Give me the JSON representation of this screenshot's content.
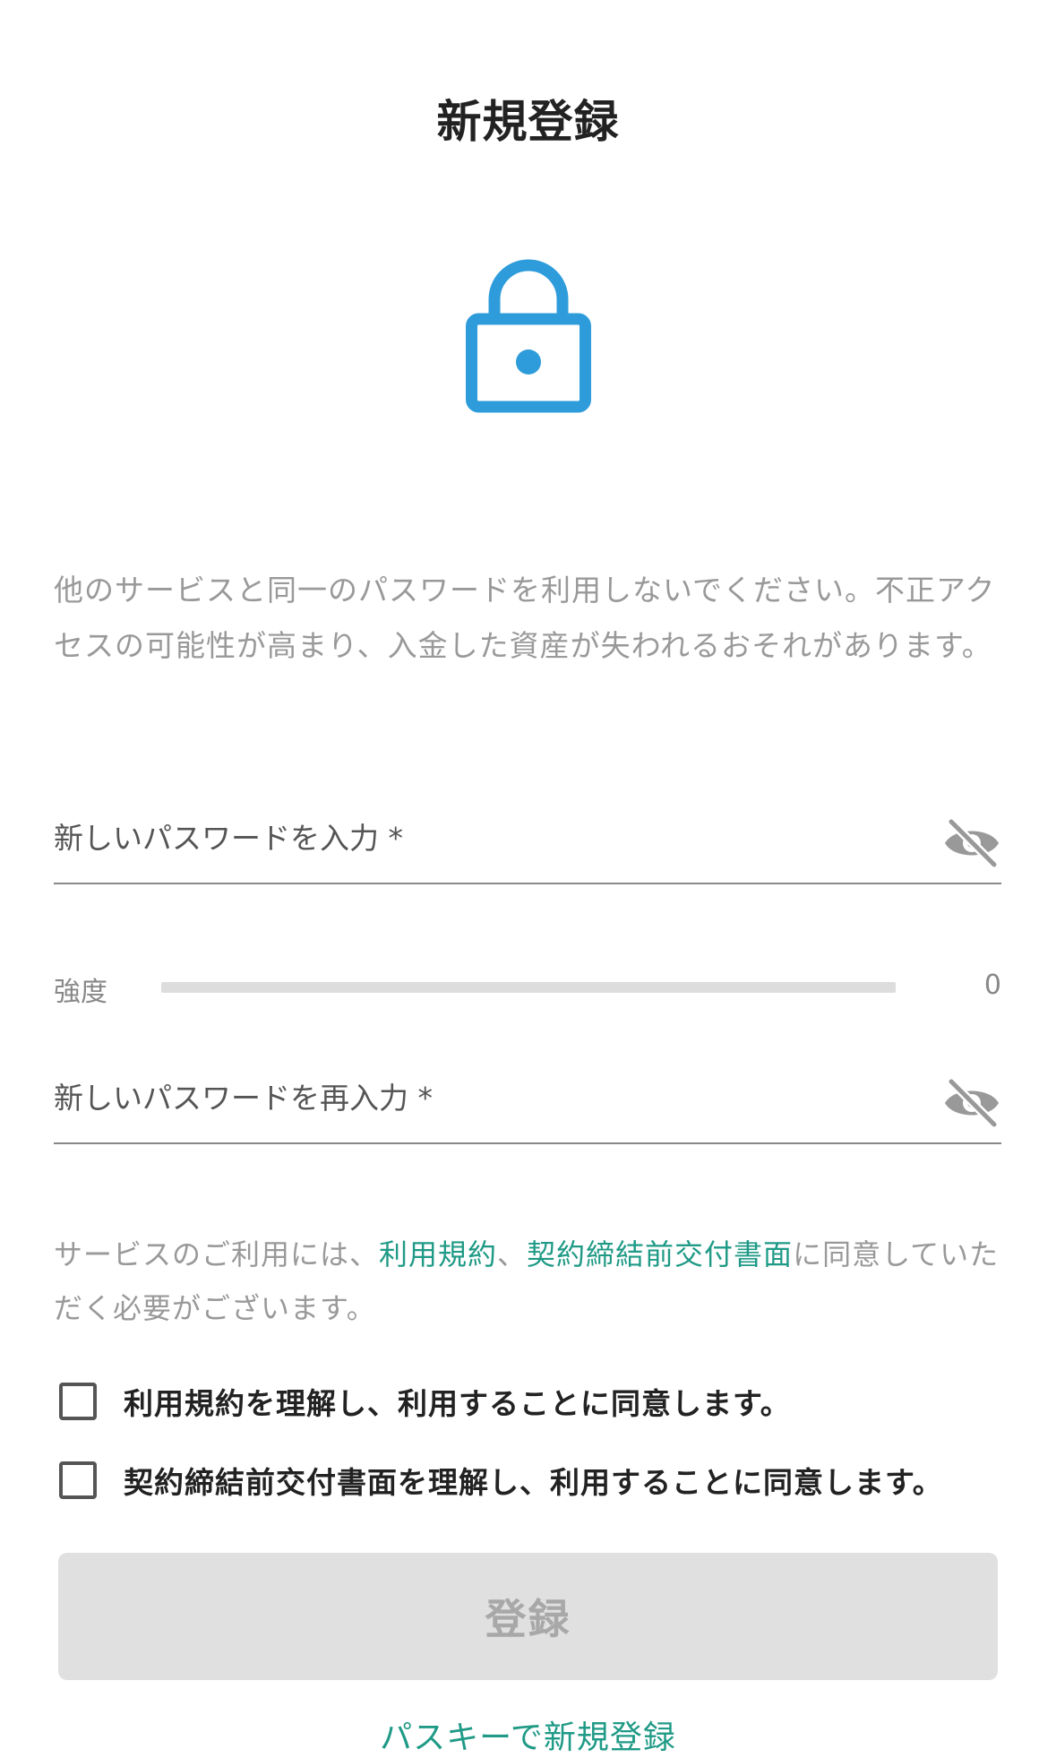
{
  "header": {
    "title": "新規登録"
  },
  "hero": {
    "icon": "lock-icon",
    "icon_color": "#2e9cdb"
  },
  "warning": {
    "text": "他のサービスと同一のパスワードを利用しないでください。不正アクセスの可能性が高まり、入金した資産が失われるおそれがあります。"
  },
  "password": {
    "placeholder": "新しいパスワードを入力 *",
    "value": "",
    "toggle_icon": "eye-off-icon"
  },
  "strength": {
    "label": "強度",
    "value": "0",
    "fraction": 0
  },
  "password_confirm": {
    "placeholder": "新しいパスワードを再入力 *",
    "value": "",
    "toggle_icon": "eye-off-icon"
  },
  "terms_note": {
    "prefix": "サービスのご利用には、",
    "link_terms": "利用規約",
    "separator": "、",
    "link_contract": "契約締結前交付書面",
    "suffix": "に同意していただく必要がございます。",
    "link_color": "#1f9a86"
  },
  "checkboxes": [
    {
      "label": "利用規約を理解し、利用することに同意します。",
      "checked": false
    },
    {
      "label": "契約締結前交付書面を理解し、利用することに同意します。",
      "checked": false
    }
  ],
  "submit": {
    "label": "登録",
    "enabled": false
  },
  "passkey": {
    "label": "パスキーで新規登録"
  }
}
